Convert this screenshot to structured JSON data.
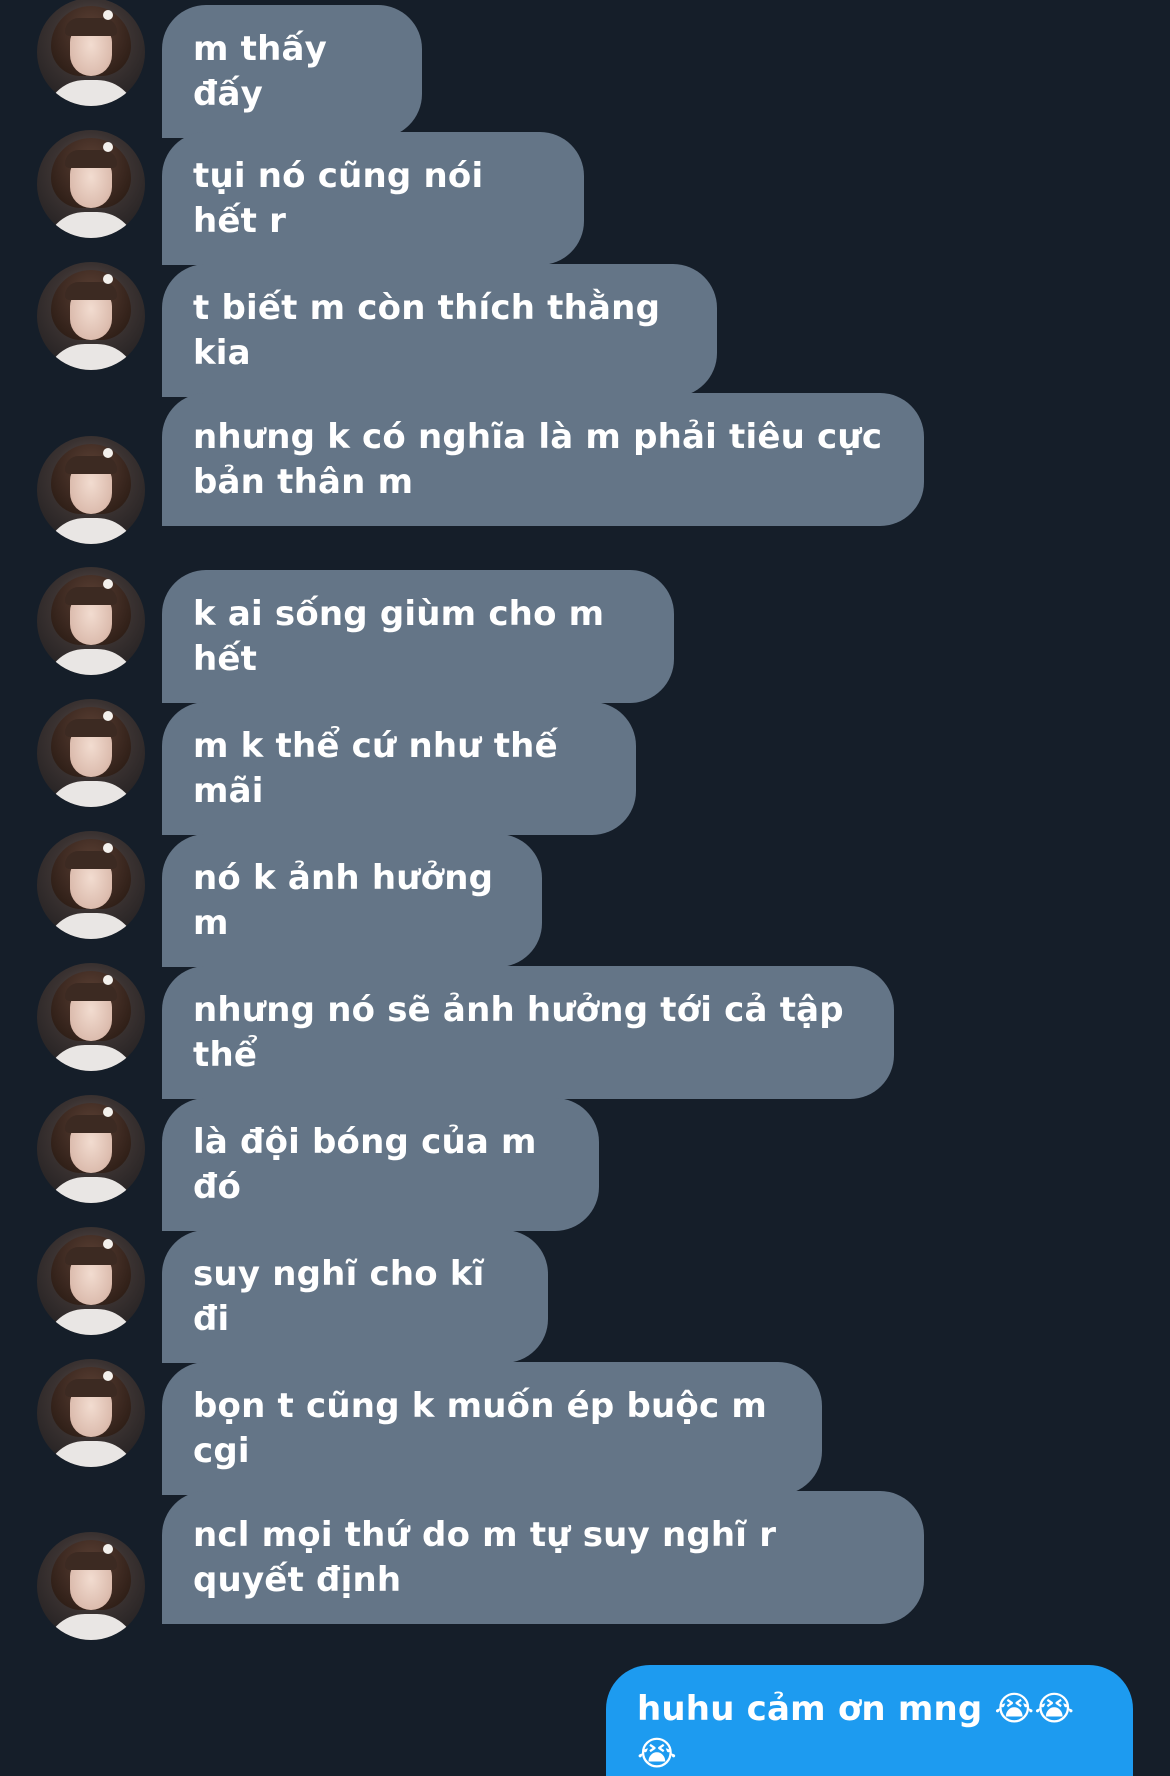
{
  "conversation": {
    "received": [
      {
        "text": "m thấy đấy"
      },
      {
        "text": "tụi nó cũng nói hết r"
      },
      {
        "text": "t biết m còn thích thằng kia"
      },
      {
        "text": "nhưng k có nghĩa là m phải tiêu cực bản thân m"
      },
      {
        "text": "k ai sống giùm cho m hết"
      },
      {
        "text": "m k thể cứ như thế mãi"
      },
      {
        "text": "nó k ảnh hưởng m"
      },
      {
        "text": "nhưng nó sẽ ảnh hưởng tới cả tập thể"
      },
      {
        "text": "là đội bóng của m đó"
      },
      {
        "text": "suy nghĩ cho kĩ đi"
      },
      {
        "text": "bọn t cũng k muốn ép buộc m cgi"
      },
      {
        "text": "ncl mọi thứ do m tự suy nghĩ r quyết định"
      }
    ],
    "sent": [
      {
        "text": "huhu cảm ơn mng 😭😭😭"
      }
    ]
  },
  "colors": {
    "background": "#151E29",
    "received_bubble": "#647587",
    "sent_bubble": "#1D9BF0",
    "text": "#FFFFFF"
  },
  "icons": {
    "avatar": "profile-photo"
  }
}
